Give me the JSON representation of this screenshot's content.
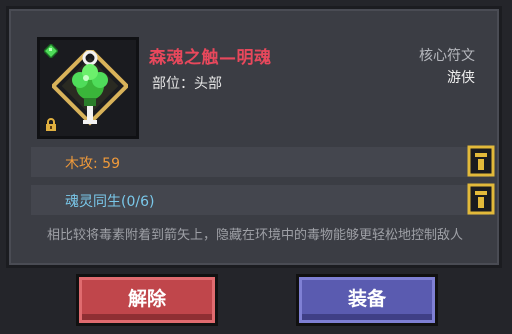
{
  "item": {
    "name": "森魂之触—明魂",
    "slot_label": "部位：",
    "slot_value": "头部",
    "category": "核心符文",
    "class": "游侠",
    "icon": "green-soul-amulet-icon"
  },
  "stats": [
    {
      "text": "木攻: 59",
      "color": "#f09a3a",
      "icon": "slot-icon"
    },
    {
      "text": "魂灵同生(0/6)",
      "color": "#7ac8ea",
      "icon": "slot-icon"
    }
  ],
  "description": "相比较将毒素附着到箭矢上，隐藏在环境中的毒物能够更轻松地控制敌人",
  "buttons": {
    "unequip": "解除",
    "equip": "装备"
  },
  "colors": {
    "title": "#e8485c",
    "unequip_button": "#c0464b",
    "equip_button": "#5a5bb0"
  }
}
